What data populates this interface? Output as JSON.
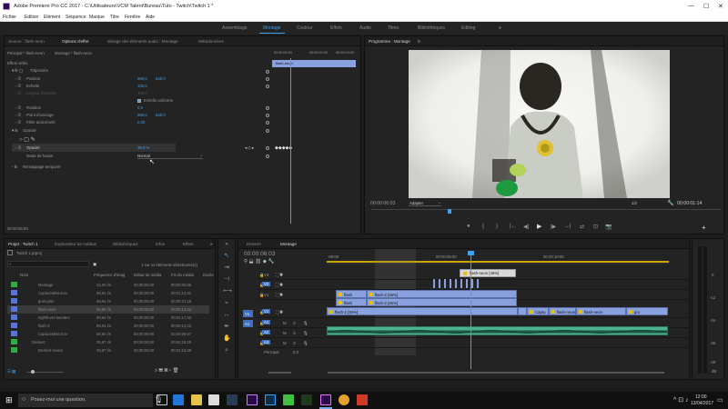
{
  "title_bar": {
    "title": "Adobe Premiere Pro CC 2017 - C:\\Utilisateurs\\VCM Talent\\Bureau\\Tuto - Twitch\\Twitch 1 *",
    "minimize": "—",
    "maximize": "☐",
    "close": "✕"
  },
  "menu": [
    "Fichier",
    "Edition",
    "Elément",
    "Séquence",
    "Marque",
    "Titre",
    "Fenêtre",
    "Aide"
  ],
  "workspaces": [
    "Assemblage",
    "Montage",
    "Couleur",
    "Effets",
    "Audio",
    "Titres",
    "Bibliothèques",
    "Editing"
  ],
  "workspace_more": "»",
  "effect_panel": {
    "tabs": [
      "Source : flash-neon",
      "Options d'effet",
      "Mixage des éléments audio : Montage",
      "Métadonnées"
    ],
    "clip_path": "Principal * flash-neon",
    "sequence_path": "Montage * flash-neon",
    "timecodes": [
      "00:00:00:00",
      "00:00:02:00",
      "00:00:04:00"
    ],
    "mini_clip": "flash-neon",
    "section_video": "Effets vidéo",
    "motion": "Trajectoire",
    "rows": [
      {
        "label": "Position",
        "value": "960,0",
        "value2": "540,0"
      },
      {
        "label": "Echelle",
        "value": "100,0",
        "value2": ""
      },
      {
        "label": "Largeur d'échelle",
        "value": "100,0",
        "value2": ""
      },
      {
        "label": "Rotation",
        "value": "0,0",
        "value2": ""
      },
      {
        "label": "Point d'ancrage",
        "value": "960,0",
        "value2": "540,0"
      },
      {
        "label": "Filtre anticrénelé",
        "value": "0,00",
        "value2": ""
      }
    ],
    "uniform": "Echelle uniforme",
    "opacity_group": "Opacité",
    "opacity_label": "Opacité",
    "opacity_value": "39,0 %",
    "blend_label": "Mode de fusion",
    "blend_value": "Normal",
    "remap": "Remappage temporel",
    "bottom_tc": "00:00:06:03"
  },
  "program": {
    "tab": "Programme : Montage",
    "tc_left": "00:00:06:03",
    "fit": "Adapter",
    "ratio": "1/2",
    "tc_right": "00:00:01:14",
    "transport": [
      "●",
      "{",
      "}",
      "|←",
      "◀|",
      "▶",
      "|▶",
      "→|",
      "⇄",
      "⊡",
      "📷"
    ],
    "add": "+"
  },
  "project": {
    "tabs": [
      "Projet : Twitch 1",
      "Explorateur de médias",
      "Bibliothèques",
      "Infos",
      "Effets"
    ],
    "more": "»",
    "project_name": "Twitch 1.prproj",
    "search_placeholder": "",
    "selection_info": "1 sur 11 éléments sélectionné(s)",
    "columns": [
      "Nom",
      "Fréquence d'imag",
      "Début du média",
      "Fin du média",
      "Durée"
    ],
    "items": [
      {
        "name": "Montage",
        "fps": "24,00 i/s",
        "start": "00;00;00;00",
        "end": "00;00;06;05",
        "dur": ""
      },
      {
        "name": "CaptureMiM.mov",
        "fps": "59,94 i/s",
        "start": "00;00;00;00",
        "end": "00;01;12;41",
        "dur": ""
      },
      {
        "name": "gros-plan",
        "fps": "59,94 i/s",
        "start": "00;00;00;00",
        "end": "00;00;21;18",
        "dur": ""
      },
      {
        "name": "flash-neon",
        "fps": "59,94 i/s",
        "start": "00;00;00;00",
        "end": "00;00;13;22",
        "dur": ""
      },
      {
        "name": "nightfever-lunettes",
        "fps": "59,94 i/s",
        "start": "00;00;00;00",
        "end": "00;01;17;43",
        "dur": ""
      },
      {
        "name": "flash-2",
        "fps": "59,94 i/s",
        "start": "00;00;00;00",
        "end": "00;00;13;22",
        "dur": ""
      },
      {
        "name": "CaptureMiM.mov",
        "fps": "59,94 i/s",
        "start": "00;00;00;00",
        "end": "00;00;08;07",
        "dur": ""
      },
      {
        "name": "Dessert",
        "fps": "29,97 i/s",
        "start": "00;00;00;00",
        "end": "00;04;15;29",
        "dur": ""
      },
      {
        "name": "Dessert scend",
        "fps": "29,97 i/s",
        "start": "00;00;00;00",
        "end": "00;04;15;29",
        "dur": ""
      }
    ]
  },
  "timeline": {
    "tabs": [
      "Dessert",
      "Montage"
    ],
    "timecode": "00:00:06:03",
    "ruler": [
      "-00:00",
      "00:00:05:00",
      "00:00:10:00"
    ],
    "tracks": [
      {
        "name": "V3",
        "kind": "video"
      },
      {
        "name": "V2",
        "kind": "video"
      },
      {
        "name": "V1",
        "kind": "video"
      },
      {
        "name": "A1",
        "kind": "audio"
      },
      {
        "name": "A2",
        "kind": "audio"
      },
      {
        "name": "A3",
        "kind": "audio"
      }
    ],
    "source_patch": [
      "V1",
      "A1"
    ],
    "track_toggles": [
      "M",
      "S"
    ],
    "master_label": "Principal",
    "master_value": "0,0",
    "tooltip_clip": "flash-neon [46%]",
    "clips_v2": [
      "flash-2 [46%]",
      "flash-2 [46%]"
    ],
    "clip_v2b": "flash-2 [46%]",
    "clip_v1": "flash-2 [46%]",
    "clip_v1_right": [
      "Captu",
      "flash-neon",
      "flash-neon",
      "gro"
    ],
    "clip_small": "flash"
  },
  "meter": {
    "labels": [
      "0",
      "-12",
      "-24",
      "-36",
      "-48",
      "dB"
    ]
  },
  "taskbar": {
    "search": "Posez-moi une question.",
    "time": "12:00",
    "date": "13/04/2017"
  }
}
